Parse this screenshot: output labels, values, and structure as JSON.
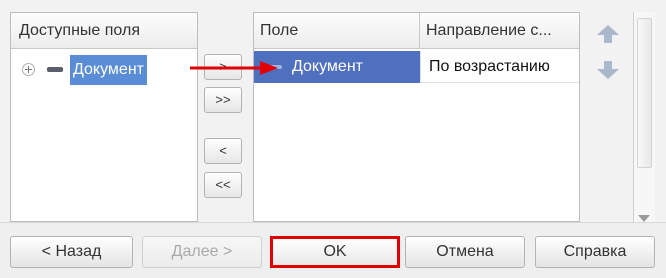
{
  "left_panel": {
    "header": "Доступные поля",
    "tree_items": [
      {
        "label": "Документ",
        "expanded": false,
        "selected": true
      }
    ]
  },
  "transfer_buttons": {
    "add": ">",
    "add_all": ">>",
    "remove": "<",
    "remove_all": "<<"
  },
  "right_panel": {
    "columns": [
      "Поле",
      "Направление с..."
    ],
    "rows": [
      {
        "field": "Документ",
        "direction": "По возрастанию",
        "selected": true
      }
    ]
  },
  "buttons": {
    "back": "< Назад",
    "next": "Далее >",
    "ok": "OK",
    "cancel": "Отмена",
    "help": "Справка"
  },
  "colors": {
    "selection": "#5b8dd6",
    "row_selection": "#4f6fbf",
    "annotation": "#e00000"
  }
}
